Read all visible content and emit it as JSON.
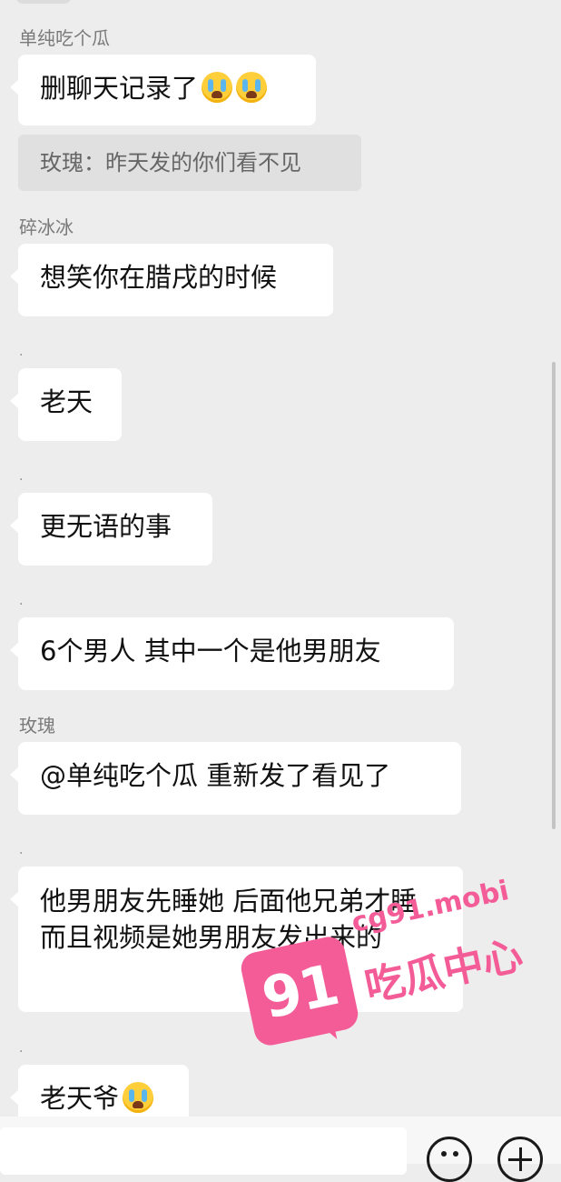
{
  "messages": [
    {
      "sender": "单纯吃个瓜",
      "text": "删聊天记录了",
      "emoji_count": 2,
      "quote": "玫瑰：昨天发的你们看不见"
    },
    {
      "sender": "碎冰冰",
      "text": "想笑你在腊戌的时候"
    },
    {
      "sender": ".",
      "text": "老天"
    },
    {
      "sender": ".",
      "text": "更无语的事"
    },
    {
      "sender": ".",
      "text": "6个男人 其中一个是他男朋友"
    },
    {
      "sender": "玫瑰",
      "text": "@单纯吃个瓜 重新发了看见了"
    },
    {
      "sender": ".",
      "text": "他男朋友先睡她 后面他兄弟才睡 而且视频是她男朋友发出来的"
    },
    {
      "sender": ".",
      "text": "老天爷",
      "emoji_count": 1
    }
  ],
  "watermark": {
    "badge": "91",
    "url": "cg91.mobi",
    "brand": "吃瓜中心",
    "color": "#f45c98"
  },
  "icons": {
    "emoji_button": "smiley-face-icon",
    "plus_button": "plus-circle-icon",
    "inline_emoji": "loudly-crying-face-emoji"
  },
  "colors": {
    "background": "#ededed",
    "bubble": "#ffffff",
    "quote_bg": "#e0e0e0"
  }
}
